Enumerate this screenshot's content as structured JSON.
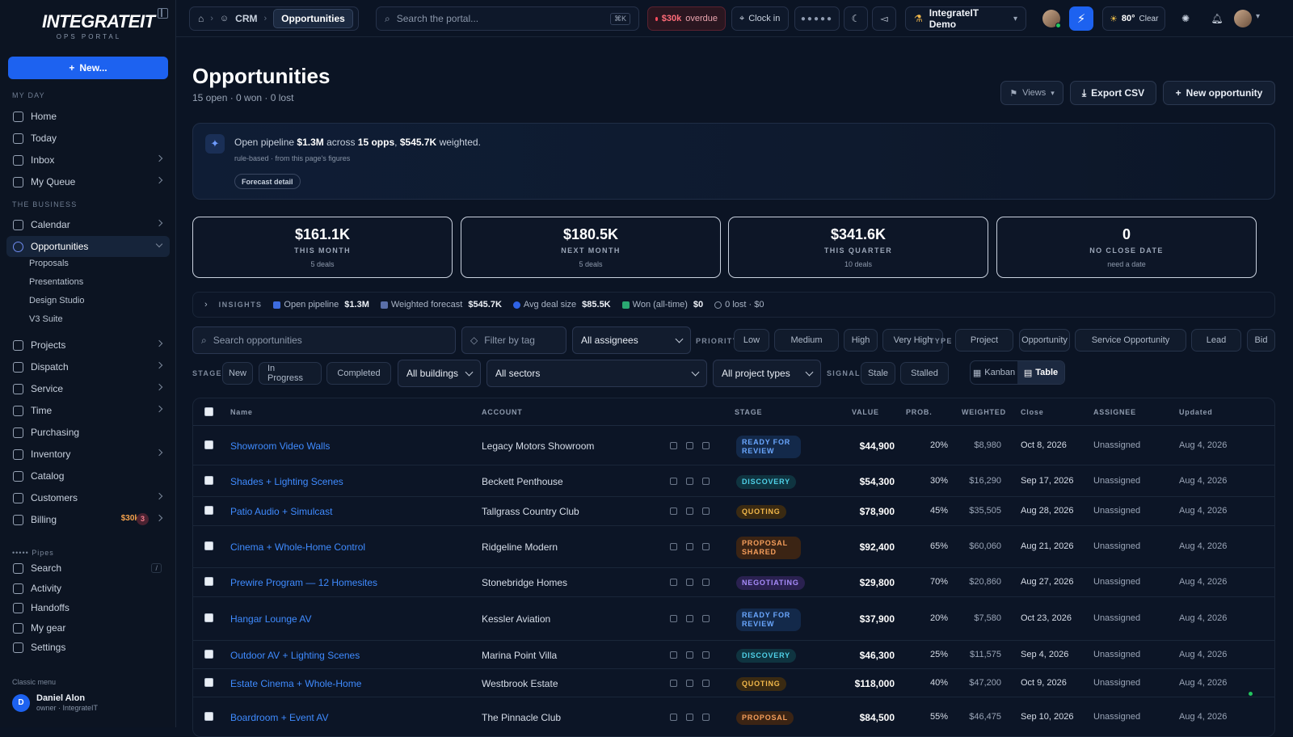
{
  "sidebar": {
    "logo_main": "INTEGRATEIT",
    "logo_sub": "OPS PORTAL",
    "new_label": "New...",
    "section_my_day": "MY DAY",
    "section_business": "THE BUSINESS",
    "my_day": [
      {
        "label": "Home",
        "chevron": false
      },
      {
        "label": "Today",
        "chevron": false
      },
      {
        "label": "Inbox",
        "chevron": true
      },
      {
        "label": "My Queue",
        "chevron": true
      }
    ],
    "business": [
      {
        "label": "Calendar"
      },
      {
        "label": "Opportunities"
      },
      {
        "label": "Projects"
      },
      {
        "label": "Dispatch"
      },
      {
        "label": "Service"
      },
      {
        "label": "Time"
      },
      {
        "label": "Purchasing"
      },
      {
        "label": "Inventory"
      },
      {
        "label": "Catalog"
      },
      {
        "label": "Customers"
      },
      {
        "label": "Billing"
      }
    ],
    "opportunities_sub": [
      "Proposals",
      "Presentations",
      "Design Studio",
      "V3 Suite"
    ],
    "billing_amount": "$30k",
    "billing_badge": "3",
    "pipes": "••••• Pipes",
    "bottom": [
      {
        "label": "Search"
      },
      {
        "label": "Activity"
      },
      {
        "label": "Handoffs"
      },
      {
        "label": "My gear"
      },
      {
        "label": "Settings"
      }
    ],
    "search_kbd": "/",
    "classic_menu": "Classic menu",
    "user_initial": "D",
    "user_name": "Daniel Alon",
    "user_role": "owner · IntegrateIT"
  },
  "topbar": {
    "crumb_crm": "CRM",
    "crumb_current": "Opportunities",
    "search_placeholder": "Search the portal...",
    "search_kbd": "⌘K",
    "overdue_amount": "$30k",
    "overdue_label": "overdue",
    "clock_in": "Clock in",
    "dots": "●●●●●",
    "workspace": "IntegrateIT Demo",
    "weather_temp": "80°",
    "weather_label": "Clear"
  },
  "page": {
    "title": "Opportunities",
    "subtitle": "15 open · 0 won · 0 lost",
    "views": "Views",
    "export": "Export CSV",
    "new_opportunity": "New opportunity"
  },
  "pipeline": {
    "prefix": "Open pipeline",
    "total": "$1.3M",
    "mid": "across",
    "opps": "15 opps",
    "sep": ",",
    "weighted": "$545.7K",
    "suffix": "weighted.",
    "note": "rule-based · from this page's figures",
    "forecast_button": "Forecast detail"
  },
  "kpis": [
    {
      "value": "$161.1K",
      "label": "THIS MONTH",
      "sub": "5 deals"
    },
    {
      "value": "$180.5K",
      "label": "NEXT MONTH",
      "sub": "5 deals"
    },
    {
      "value": "$341.6K",
      "label": "THIS QUARTER",
      "sub": "10 deals"
    },
    {
      "value": "0",
      "label": "NO CLOSE DATE",
      "sub": "need a date"
    }
  ],
  "insights": {
    "label": "INSIGHTS",
    "open_pipeline_label": "Open pipeline",
    "open_pipeline": "$1.3M",
    "weighted_label": "Weighted forecast",
    "weighted": "$545.7K",
    "avg_label": "Avg deal size",
    "avg": "$85.5K",
    "won_label": "Won (all-time)",
    "won": "$0",
    "lost": "0 lost · $0"
  },
  "filters": {
    "search_placeholder": "Search opportunities",
    "tag_placeholder": "Filter by tag",
    "assignees": "All assignees",
    "priority_label": "PRIORITY",
    "priorities": [
      "Low",
      "Medium",
      "High",
      "Very High"
    ],
    "type_label": "TYPE",
    "types": [
      "Project",
      "Opportunity",
      "Service Opportunity",
      "Lead",
      "Bid"
    ],
    "stage_label": "STAGE",
    "stages": [
      "New",
      "In Progress",
      "Completed"
    ],
    "buildings": "All buildings",
    "sectors": "All sectors",
    "project_types": "All project types",
    "signal_label": "SIGNAL",
    "signals": [
      "Stale",
      "Stalled"
    ],
    "kanban": "Kanban",
    "table": "Table"
  },
  "table": {
    "headers": {
      "name": "Name",
      "account": "ACCOUNT",
      "stage": "STAGE",
      "value": "VALUE",
      "prob": "PROB.",
      "weighted": "WEIGHTED",
      "close": "Close",
      "assignee": "ASSIGNEE",
      "updated": "Updated"
    },
    "rows": [
      {
        "name": "Showroom Video Walls",
        "account": "Legacy Motors Showroom",
        "stage": "READY FOR REVIEW",
        "stage_color": "#6aa7ff",
        "stage_bg": "#13294a",
        "value": "$44,900",
        "prob": "20%",
        "weighted": "$8,980",
        "close": "Oct 8, 2026",
        "assignee": "Unassigned",
        "updated": "Aug 4, 2026"
      },
      {
        "name": "Shades + Lighting Scenes",
        "account": "Beckett Penthouse",
        "stage": "DISCOVERY",
        "stage_color": "#4fd1e8",
        "stage_bg": "#0f3440",
        "value": "$54,300",
        "prob": "30%",
        "weighted": "$16,290",
        "close": "Sep 17, 2026",
        "assignee": "Unassigned",
        "updated": "Aug 4, 2026"
      },
      {
        "name": "Patio Audio + Simulcast",
        "account": "Tallgrass Country Club",
        "stage": "QUOTING",
        "stage_color": "#f2b84b",
        "stage_bg": "#3a2a12",
        "value": "$78,900",
        "prob": "45%",
        "weighted": "$35,505",
        "close": "Aug 28, 2026",
        "assignee": "Unassigned",
        "updated": "Aug 4, 2026"
      },
      {
        "name": "Cinema + Whole-Home Control",
        "account": "Ridgeline Modern",
        "stage": "PROPOSAL SHARED",
        "stage_color": "#f59e5b",
        "stage_bg": "#3b2414",
        "value": "$92,400",
        "prob": "65%",
        "weighted": "$60,060",
        "close": "Aug 21, 2026",
        "assignee": "Unassigned",
        "updated": "Aug 4, 2026"
      },
      {
        "name": "Prewire Program — 12 Homesites",
        "account": "Stonebridge Homes",
        "stage": "NEGOTIATING",
        "stage_color": "#a78bfa",
        "stage_bg": "#2a2150",
        "value": "$29,800",
        "prob": "70%",
        "weighted": "$20,860",
        "close": "Aug 27, 2026",
        "assignee": "Unassigned",
        "updated": "Aug 4, 2026"
      },
      {
        "name": "Hangar Lounge AV",
        "account": "Kessler Aviation",
        "stage": "READY FOR REVIEW",
        "stage_color": "#6aa7ff",
        "stage_bg": "#13294a",
        "value": "$37,900",
        "prob": "20%",
        "weighted": "$7,580",
        "close": "Oct 23, 2026",
        "assignee": "Unassigned",
        "updated": "Aug 4, 2026"
      },
      {
        "name": "Outdoor AV + Lighting Scenes",
        "account": "Marina Point Villa",
        "stage": "DISCOVERY",
        "stage_color": "#4fd1e8",
        "stage_bg": "#0f3440",
        "value": "$46,300",
        "prob": "25%",
        "weighted": "$11,575",
        "close": "Sep 4, 2026",
        "assignee": "Unassigned",
        "updated": "Aug 4, 2026"
      },
      {
        "name": "Estate Cinema + Whole-Home",
        "account": "Westbrook Estate",
        "stage": "QUOTING",
        "stage_color": "#f2b84b",
        "stage_bg": "#3a2a12",
        "value": "$118,000",
        "prob": "40%",
        "weighted": "$47,200",
        "close": "Oct 9, 2026",
        "assignee": "Unassigned",
        "updated": "Aug 4, 2026"
      },
      {
        "name": "Boardroom + Event AV",
        "account": "The Pinnacle Club",
        "stage": "PROPOSAL",
        "stage_color": "#f59e5b",
        "stage_bg": "#3b2414",
        "value": "$84,500",
        "prob": "55%",
        "weighted": "$46,475",
        "close": "Sep 10, 2026",
        "assignee": "Unassigned",
        "updated": "Aug 4, 2026"
      }
    ]
  }
}
